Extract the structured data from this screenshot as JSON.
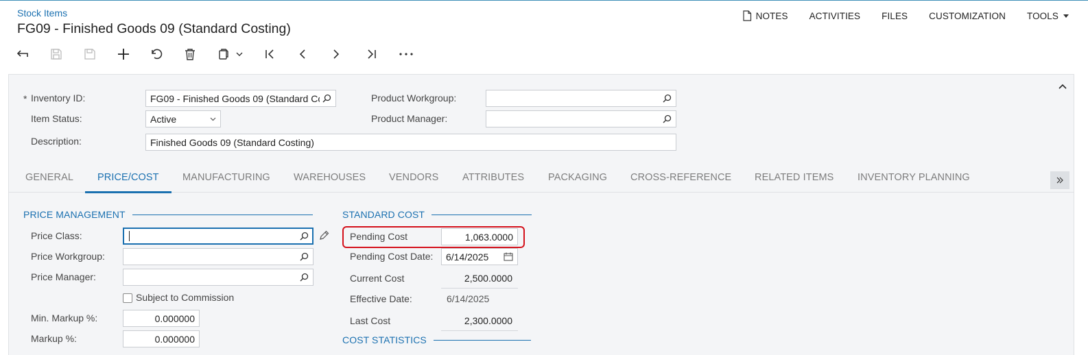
{
  "header": {
    "breadcrumb": "Stock Items",
    "title": "FG09 - Finished Goods 09 (Standard Costing)",
    "actions": {
      "notes": "NOTES",
      "activities": "ACTIVITIES",
      "files": "FILES",
      "customization": "CUSTOMIZATION",
      "tools": "TOOLS"
    }
  },
  "toolbar": {
    "icons": [
      "back-icon",
      "save-close-icon",
      "save-icon",
      "add-icon",
      "undo-icon",
      "delete-icon",
      "copy-paste-icon",
      "first-record-icon",
      "previous-record-icon",
      "next-record-icon",
      "last-record-icon",
      "more-icon"
    ]
  },
  "summary": {
    "required_mark": "*",
    "inventory_id_label": "Inventory ID:",
    "inventory_id_value": "FG09 - Finished Goods 09 (Standard Costing)",
    "item_status_label": "Item Status:",
    "item_status_value": "Active",
    "description_label": "Description:",
    "description_value": "Finished Goods 09 (Standard Costing)",
    "product_workgroup_label": "Product Workgroup:",
    "product_workgroup_value": "",
    "product_manager_label": "Product Manager:",
    "product_manager_value": ""
  },
  "tabs": [
    {
      "label": "GENERAL",
      "active": false
    },
    {
      "label": "PRICE/COST",
      "active": true
    },
    {
      "label": "MANUFACTURING",
      "active": false
    },
    {
      "label": "WAREHOUSES",
      "active": false
    },
    {
      "label": "VENDORS",
      "active": false
    },
    {
      "label": "ATTRIBUTES",
      "active": false
    },
    {
      "label": "PACKAGING",
      "active": false
    },
    {
      "label": "CROSS-REFERENCE",
      "active": false
    },
    {
      "label": "RELATED ITEMS",
      "active": false
    },
    {
      "label": "INVENTORY PLANNING",
      "active": false
    }
  ],
  "price_management": {
    "header": "PRICE MANAGEMENT",
    "price_class_label": "Price Class:",
    "price_class_value": "",
    "price_workgroup_label": "Price Workgroup:",
    "price_workgroup_value": "",
    "price_manager_label": "Price Manager:",
    "price_manager_value": "",
    "subject_to_commission_label": "Subject to Commission",
    "subject_to_commission_checked": false,
    "min_markup_label": "Min. Markup %:",
    "min_markup_value": "0.000000",
    "markup_label": "Markup %:",
    "markup_value": "0.000000"
  },
  "standard_cost": {
    "header": "STANDARD COST",
    "pending_cost_label": "Pending Cost",
    "pending_cost_value": "1,063.0000",
    "pending_cost_date_label": "Pending Cost Date:",
    "pending_cost_date_value": "6/14/2025",
    "current_cost_label": "Current Cost",
    "current_cost_value": "2,500.0000",
    "effective_date_label": "Effective Date:",
    "effective_date_value": "6/14/2025",
    "last_cost_label": "Last Cost",
    "last_cost_value": "2,300.0000"
  },
  "cost_statistics": {
    "header": "COST STATISTICS"
  },
  "colors": {
    "accent": "#1a70b0",
    "highlight": "#d4101a",
    "panel_bg": "#f4f5f7"
  }
}
